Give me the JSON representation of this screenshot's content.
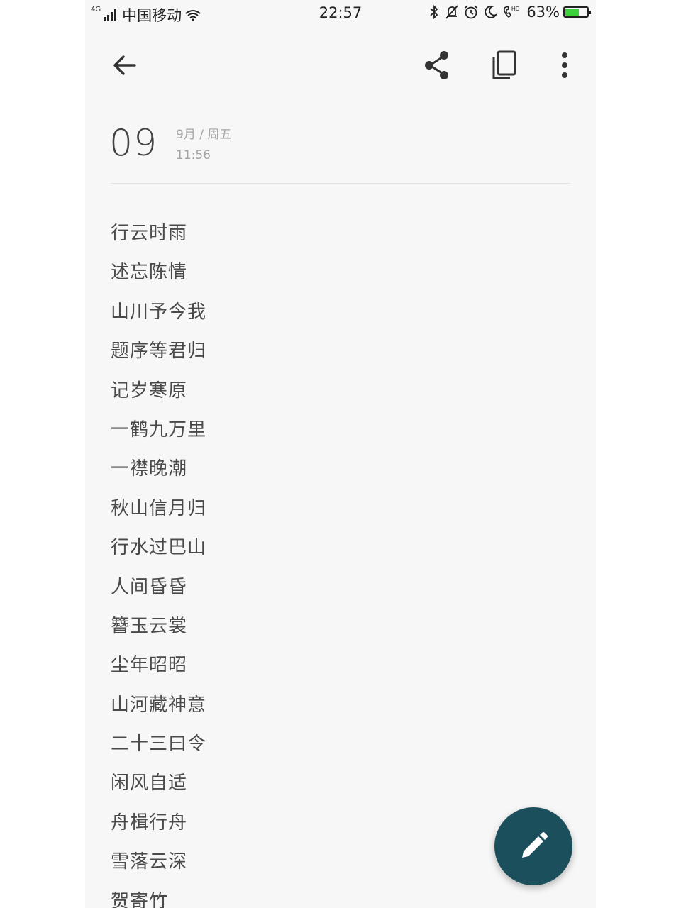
{
  "status_bar": {
    "network_type": "4G",
    "carrier": "中国移动",
    "time": "22:57",
    "battery_percent": "63%",
    "battery_level": 0.63,
    "battery_color": "#3cd13c",
    "icons": [
      "bluetooth-icon",
      "mute-icon",
      "alarm-icon",
      "do-not-disturb-icon",
      "hd-call-icon"
    ]
  },
  "toolbar": {
    "back_icon": "arrow-left-icon",
    "share_icon": "share-icon",
    "copy_icon": "copy-icon",
    "more_icon": "more-vertical-icon"
  },
  "note": {
    "day": "09",
    "month_weekday": "9月 / 周五",
    "time": "11:56",
    "lines": [
      "行云时雨",
      "述忘陈情",
      "山川予今我",
      "题序等君归",
      "记岁寒原",
      "一鹤九万里",
      "一襟晚潮",
      "秋山信月归",
      "行水过巴山",
      "人间昏昏",
      "簪玉云裳",
      "尘年昭昭",
      "山河藏神意",
      "二十三曰令",
      "闲风自适",
      "舟楫行舟",
      "雪落云深",
      "贺寄竹"
    ]
  },
  "fab": {
    "icon": "edit-pencil-icon",
    "color": "#1b4f5c"
  }
}
